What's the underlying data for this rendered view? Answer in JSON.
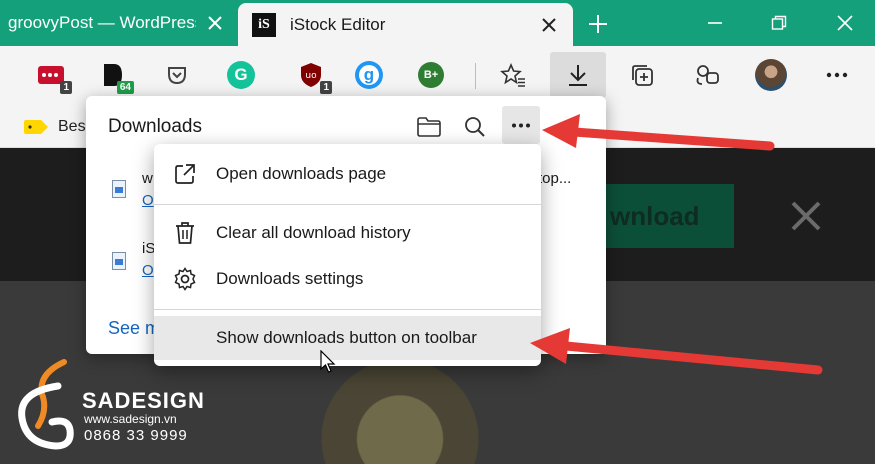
{
  "tabs": [
    {
      "title": "groovyPost — WordPress",
      "active": false
    },
    {
      "title": "iStock Editor",
      "active": true,
      "favicon": "iS"
    }
  ],
  "toolbar": {
    "extensions": [
      {
        "icon": "lastpass-icon",
        "badge": "1"
      },
      {
        "icon": "docs-extension-icon",
        "badge": "64"
      },
      {
        "icon": "pocket-icon"
      },
      {
        "icon": "grammarly-icon",
        "label": "G"
      },
      {
        "icon": "ublock-icon",
        "badge": "1"
      },
      {
        "icon": "g-extension-icon",
        "label": "g"
      },
      {
        "icon": "bplus-icon",
        "label": "B+"
      }
    ]
  },
  "favorites": {
    "first_label": "Bes"
  },
  "downloads_panel": {
    "title": "Downloads",
    "items": [
      {
        "name_start": "w",
        "name_end": "top...",
        "link": "O"
      },
      {
        "name_start": "iS",
        "link": "O"
      }
    ],
    "see_more": "See m"
  },
  "context_menu": {
    "items": [
      {
        "label": "Open downloads page",
        "icon": "open-external-icon"
      },
      {
        "label": "Clear all download history",
        "icon": "trash-icon"
      },
      {
        "label": "Downloads settings",
        "icon": "gear-icon"
      },
      {
        "label": "Show downloads button on toolbar",
        "icon": ""
      }
    ]
  },
  "page": {
    "download_button": "wnload",
    "fragment": "e"
  },
  "watermark": {
    "brand": "SADESIGN",
    "url": "www.sadesign.vn",
    "phone": "0868 33 9999"
  },
  "colors": {
    "tabbar": "#14a07a",
    "arrow": "#e53935",
    "link": "#1565c0"
  }
}
